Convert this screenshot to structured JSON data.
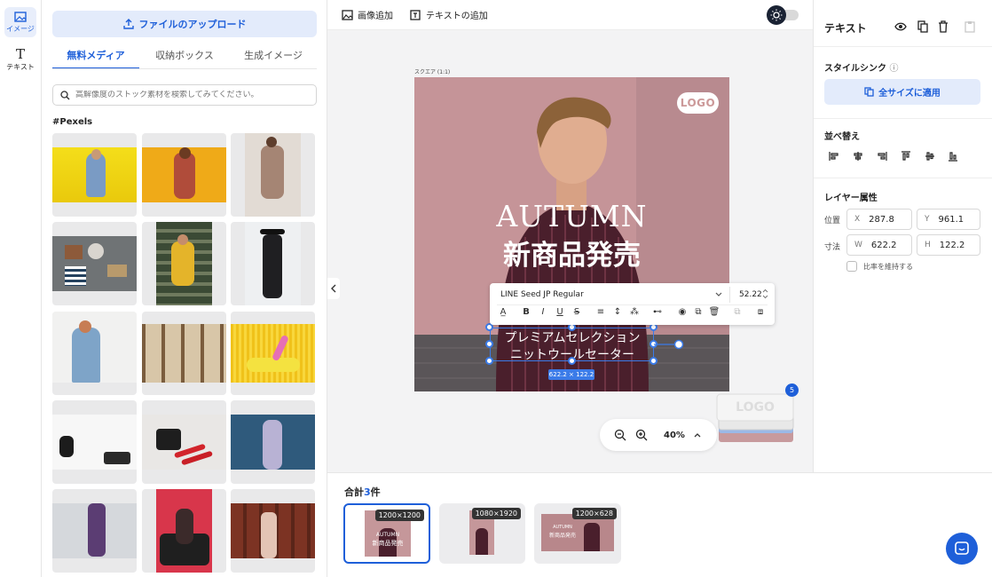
{
  "rail": {
    "items": [
      {
        "label": "イメージ"
      },
      {
        "label": "テキスト"
      }
    ]
  },
  "panel": {
    "upload_label": "ファイルのアップロード",
    "tabs": [
      {
        "label": "無料メディア"
      },
      {
        "label": "収納ボックス"
      },
      {
        "label": "生成イメージ"
      }
    ],
    "search_placeholder": "高解像度のストック素材を検索してみてください。",
    "section_title": "#Pexels"
  },
  "topbar": {
    "add_image": "画像追加",
    "add_text": "テキストの追加"
  },
  "design": {
    "size_label": "スクエア (1:1)",
    "logo": "LOGO",
    "headline1": "AUTUMN",
    "headline2": "新商品発売",
    "sub1": "プレミアムセレクション",
    "sub2": "ニットウールセーター",
    "dimensions": "622.2 × 122.2"
  },
  "text_toolbar": {
    "font": "LINE Seed JP Regular",
    "size": "52.22"
  },
  "zoom": {
    "level": "40%"
  },
  "stack_count": "5",
  "stack_logo": "LOGO",
  "bottom": {
    "total_prefix": "合計",
    "total_count": "3",
    "total_suffix": "件",
    "sizes": [
      {
        "label": "1200×1200"
      },
      {
        "label": "1080×1920"
      },
      {
        "label": "1200×628"
      }
    ]
  },
  "rpanel": {
    "title": "テキスト",
    "style_sync": "スタイルシンク",
    "apply_all": "全サイズに適用",
    "arrange": "並べ替え",
    "layer_props": "レイヤー属性",
    "position_label": "位置",
    "size_label": "寸法",
    "x": {
      "key": "X",
      "value": "287.8"
    },
    "y": {
      "key": "Y",
      "value": "961.1"
    },
    "w": {
      "key": "W",
      "value": "622.2"
    },
    "h": {
      "key": "H",
      "value": "122.2"
    },
    "keep_ratio": "比率を維持する"
  },
  "colors": {
    "accent": "#1e5fd9",
    "selection": "#3b7be8"
  }
}
